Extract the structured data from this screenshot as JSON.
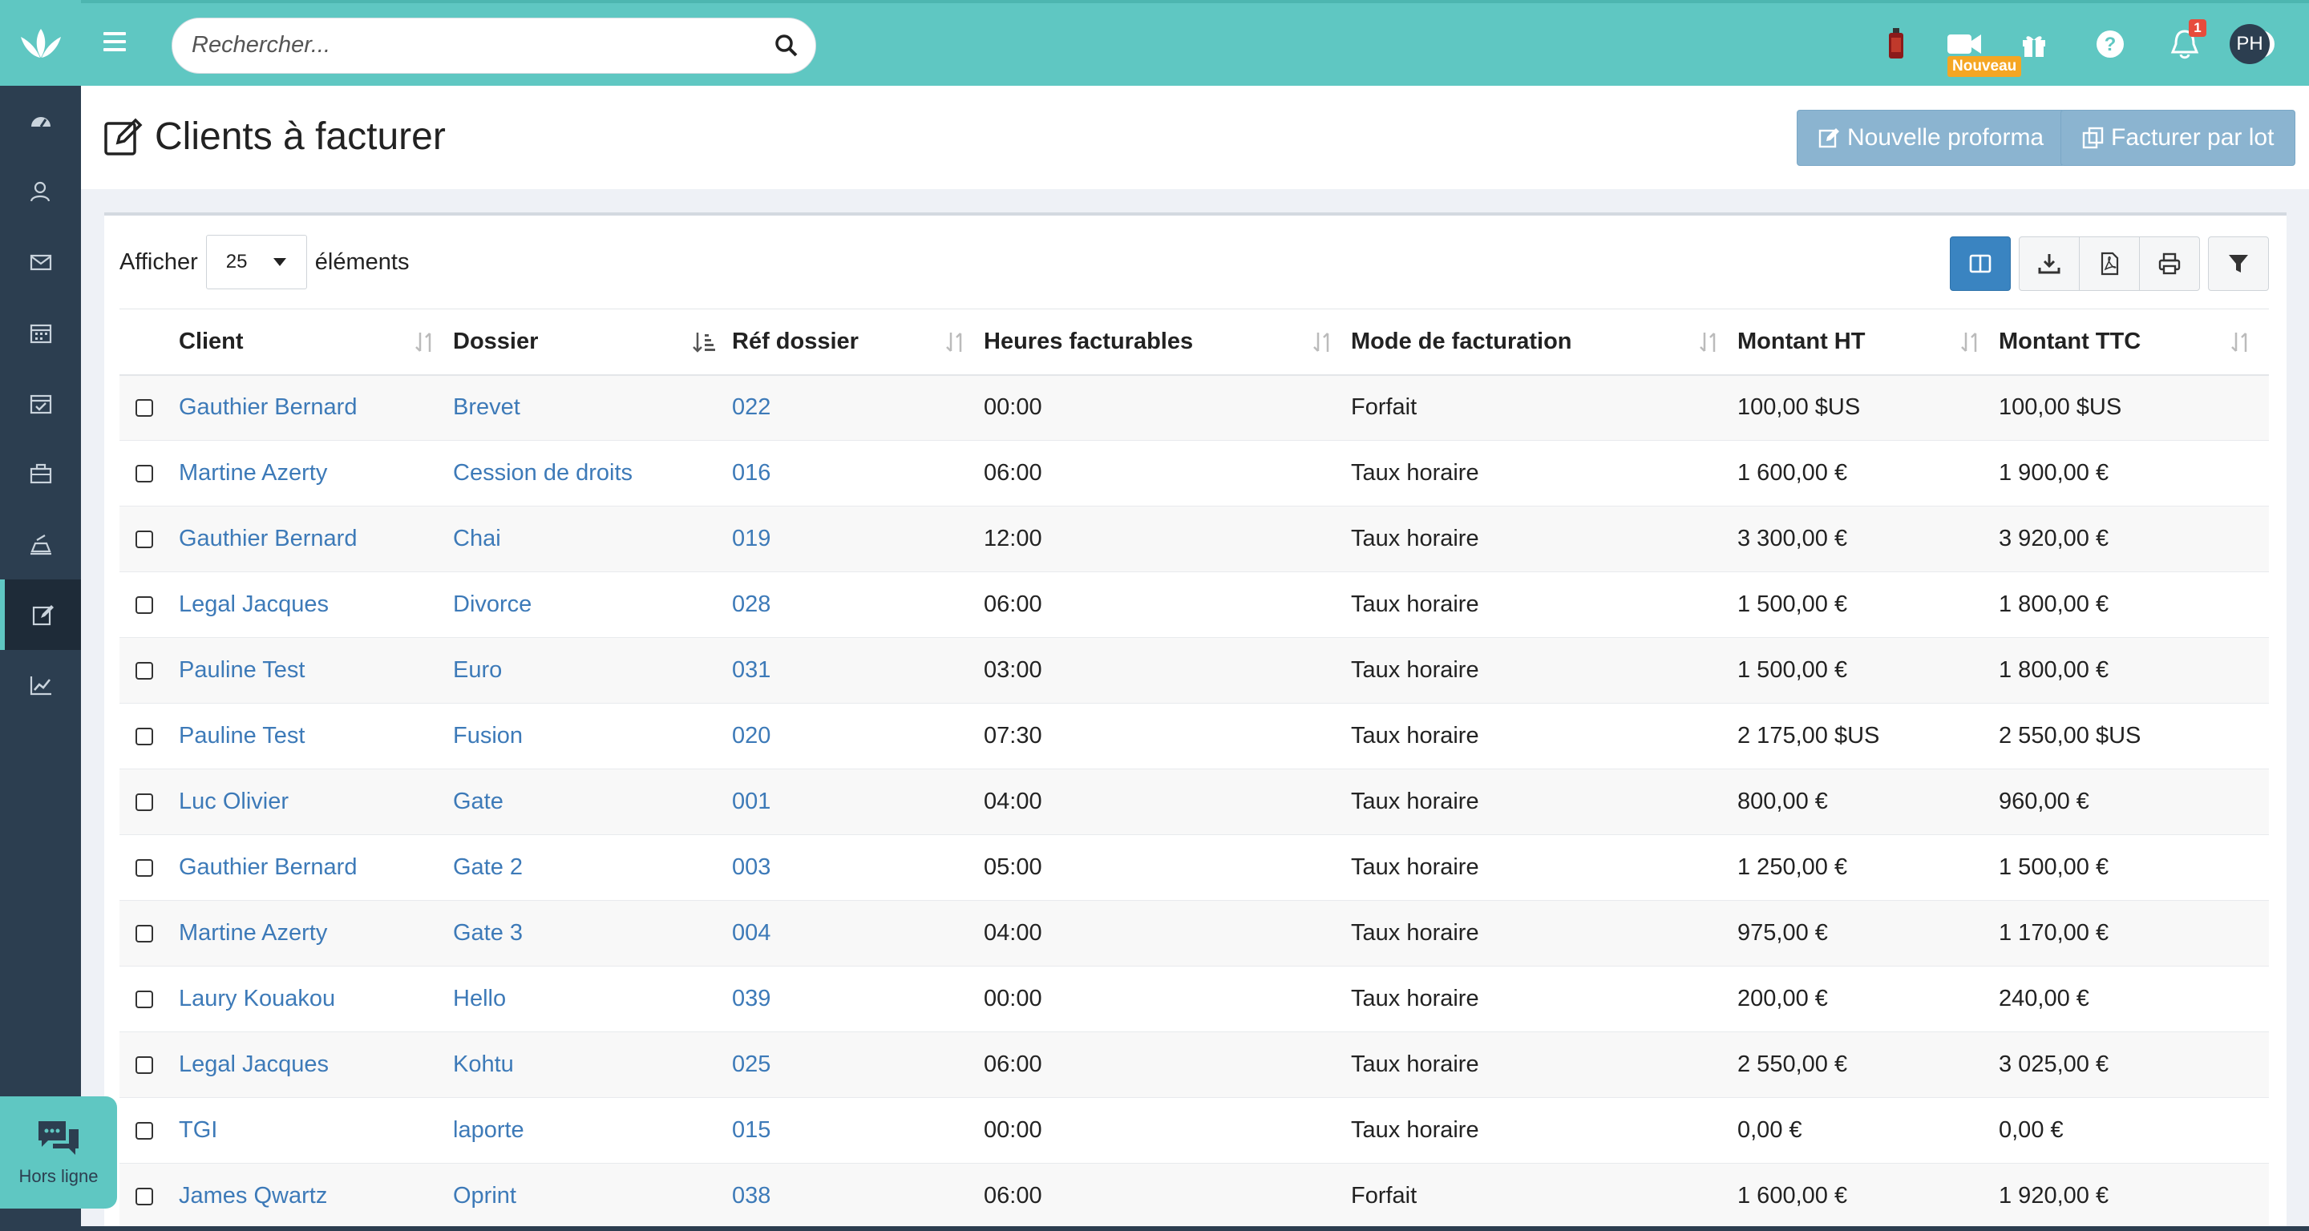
{
  "topbar": {
    "search_placeholder": "Rechercher...",
    "video_badge": "Nouveau",
    "notifications_count": "1",
    "avatar_initials": "PH"
  },
  "sidebar": {
    "items": [
      "dashboard-icon",
      "contacts-icon",
      "mail-icon",
      "calendar-icon",
      "tasks-icon",
      "briefcase-icon",
      "timer-icon",
      "billing-icon",
      "stats-icon"
    ],
    "active_index": 7
  },
  "page": {
    "title": "Clients à facturer",
    "btn_new_proforma": "Nouvelle proforma",
    "btn_bulk_invoice": "Facturer par lot"
  },
  "length": {
    "before": "Afficher",
    "value": "25",
    "after": "éléments"
  },
  "table": {
    "headers": [
      "Client",
      "Dossier",
      "Réf dossier",
      "Heures facturables",
      "Mode de facturation",
      "Montant HT",
      "Montant TTC"
    ],
    "rows": [
      [
        "Gauthier Bernard",
        "Brevet",
        "022",
        "00:00",
        "Forfait",
        "100,00 $US",
        "100,00 $US"
      ],
      [
        "Martine Azerty",
        "Cession de droits",
        "016",
        "06:00",
        "Taux horaire",
        "1 600,00 €",
        "1 900,00 €"
      ],
      [
        "Gauthier Bernard",
        "Chai",
        "019",
        "12:00",
        "Taux horaire",
        "3 300,00 €",
        "3 920,00 €"
      ],
      [
        "Legal Jacques",
        "Divorce",
        "028",
        "06:00",
        "Taux horaire",
        "1 500,00 €",
        "1 800,00 €"
      ],
      [
        "Pauline Test",
        "Euro",
        "031",
        "03:00",
        "Taux horaire",
        "1 500,00 €",
        "1 800,00 €"
      ],
      [
        "Pauline Test",
        "Fusion",
        "020",
        "07:30",
        "Taux horaire",
        "2 175,00 $US",
        "2 550,00 $US"
      ],
      [
        "Luc Olivier",
        "Gate",
        "001",
        "04:00",
        "Taux horaire",
        "800,00 €",
        "960,00 €"
      ],
      [
        "Gauthier Bernard",
        "Gate 2",
        "003",
        "05:00",
        "Taux horaire",
        "1 250,00 €",
        "1 500,00 €"
      ],
      [
        "Martine Azerty",
        "Gate 3",
        "004",
        "04:00",
        "Taux horaire",
        "975,00 €",
        "1 170,00 €"
      ],
      [
        "Laury Kouakou",
        "Hello",
        "039",
        "00:00",
        "Taux horaire",
        "200,00 €",
        "240,00 €"
      ],
      [
        "Legal Jacques",
        "Kohtu",
        "025",
        "06:00",
        "Taux horaire",
        "2 550,00 €",
        "3 025,00 €"
      ],
      [
        "TGI",
        "laporte",
        "015",
        "00:00",
        "Taux horaire",
        "0,00 €",
        "0,00 €"
      ],
      [
        "James Qwartz",
        "Oprint",
        "038",
        "06:00",
        "Forfait",
        "1 600,00 €",
        "1 920,00 €"
      ]
    ]
  },
  "chat": {
    "status": "Hors ligne"
  },
  "colors": {
    "teal": "#5fc7c2",
    "sidebar": "#2c3e50",
    "link": "#3d7ab8",
    "button": "#8bb4d0"
  }
}
